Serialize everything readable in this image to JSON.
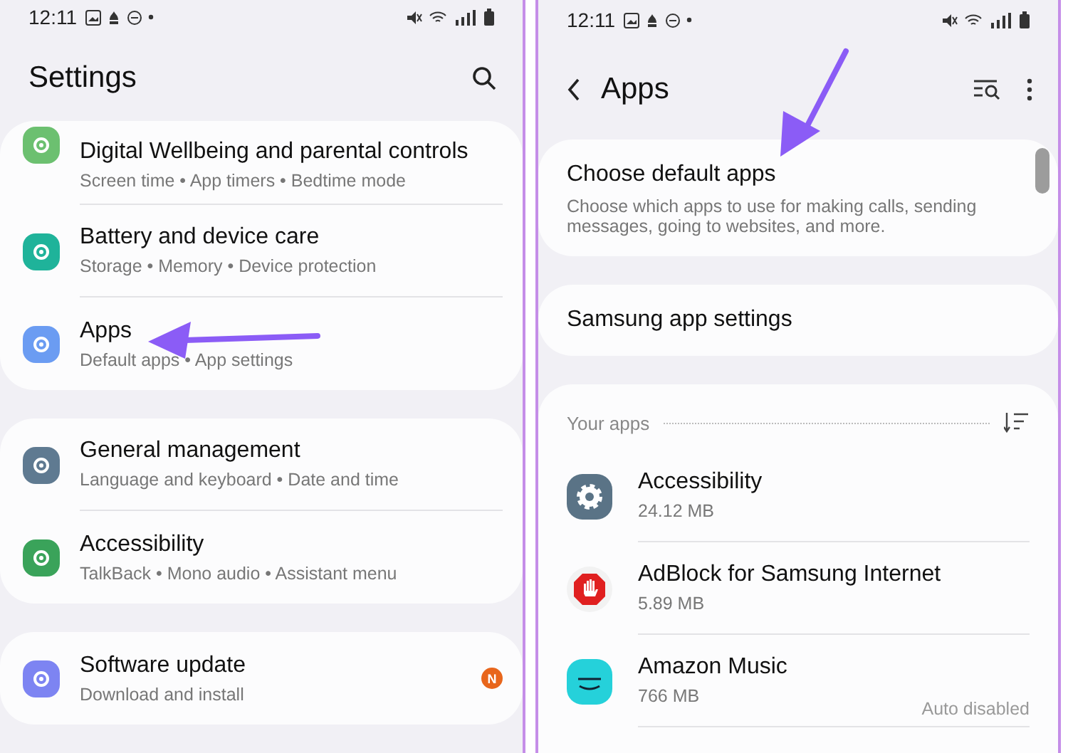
{
  "left_screen": {
    "status_bar": {
      "time": "12:11"
    },
    "title": "Settings",
    "groups": [
      {
        "items": [
          {
            "title": "Digital Wellbeing and parental controls",
            "subtitle": "Screen time  •  App timers  •  Bedtime mode",
            "color": "#6cc070"
          },
          {
            "title": "Battery and device care",
            "subtitle": "Storage  •  Memory  •  Device protection",
            "color": "#1fb39a"
          },
          {
            "title": "Apps",
            "subtitle": "Default apps  •  App settings",
            "color": "#6b9cf2"
          }
        ]
      },
      {
        "items": [
          {
            "title": "General management",
            "subtitle": "Language and keyboard  •  Date and time",
            "color": "#5f7a91"
          },
          {
            "title": "Accessibility",
            "subtitle": "TalkBack  •  Mono audio  •  Assistant menu",
            "color": "#3aa35a"
          }
        ]
      },
      {
        "items": [
          {
            "title": "Software update",
            "subtitle": "Download and install",
            "color": "#7d84f2",
            "badge": "N"
          }
        ]
      }
    ]
  },
  "right_screen": {
    "status_bar": {
      "time": "12:11"
    },
    "title": "Apps",
    "default_apps": {
      "title": "Choose default apps",
      "description": "Choose which apps to use for making calls, sending messages, going to websites, and more."
    },
    "samsung_app_settings": "Samsung app settings",
    "your_apps": {
      "heading": "Your apps",
      "apps": [
        {
          "kind": "gear",
          "name": "Accessibility",
          "size": "24.12 MB"
        },
        {
          "kind": "stop",
          "name": "AdBlock for Samsung Internet",
          "size": "5.89 MB"
        },
        {
          "kind": "music",
          "name": "Amazon Music",
          "size": "766 MB",
          "note": "Auto disabled"
        }
      ]
    }
  }
}
